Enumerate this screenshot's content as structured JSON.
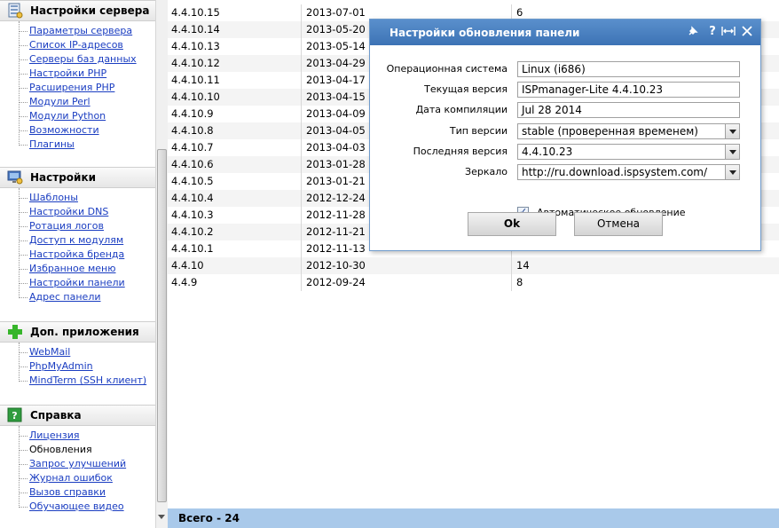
{
  "sidebar": {
    "sections": [
      {
        "title": "Настройки сервера",
        "icon": "server-settings-icon",
        "items": [
          "Параметры сервера",
          "Список IP-адресов",
          "Серверы баз данных",
          "Настройки PHP",
          "Расширения PHP",
          "Модули Perl",
          "Модули Python",
          "Возможности",
          "Плагины"
        ]
      },
      {
        "title": "Настройки",
        "icon": "settings-icon",
        "items": [
          "Шаблоны",
          "Настройки DNS",
          "Ротация логов",
          "Доступ к модулям",
          "Настройка бренда",
          "Избранное меню",
          "Настройки панели",
          "Адрес панели"
        ]
      },
      {
        "title": "Доп. приложения",
        "icon": "plus-icon",
        "items": [
          "WebMail",
          "PhpMyAdmin",
          "MindTerm (SSH клиент)"
        ]
      },
      {
        "title": "Справка",
        "icon": "help-icon",
        "items": [
          "Лицензия",
          "Обновления",
          "Запрос улучшений",
          "Журнал ошибок",
          "Вызов справки",
          "Обучающее видео"
        ],
        "active": "Обновления"
      }
    ]
  },
  "table": {
    "rows": [
      [
        "4.4.10.15",
        "2013-07-01",
        "6"
      ],
      [
        "4.4.10.14",
        "2013-05-20",
        ""
      ],
      [
        "4.4.10.13",
        "2013-05-14",
        ""
      ],
      [
        "4.4.10.12",
        "2013-04-29",
        ""
      ],
      [
        "4.4.10.11",
        "2013-04-17",
        ""
      ],
      [
        "4.4.10.10",
        "2013-04-15",
        ""
      ],
      [
        "4.4.10.9",
        "2013-04-09",
        ""
      ],
      [
        "4.4.10.8",
        "2013-04-05",
        ""
      ],
      [
        "4.4.10.7",
        "2013-04-03",
        ""
      ],
      [
        "4.4.10.6",
        "2013-01-28",
        ""
      ],
      [
        "4.4.10.5",
        "2013-01-21",
        ""
      ],
      [
        "4.4.10.4",
        "2012-12-24",
        ""
      ],
      [
        "4.4.10.3",
        "2012-11-28",
        ""
      ],
      [
        "4.4.10.2",
        "2012-11-21",
        ""
      ],
      [
        "4.4.10.1",
        "2012-11-13",
        ""
      ],
      [
        "4.4.10",
        "2012-10-30",
        "14"
      ],
      [
        "4.4.9",
        "2012-09-24",
        "8"
      ]
    ],
    "footer": "Всего - 24"
  },
  "dialog": {
    "title": "Настройки обновления панели",
    "header_icons": [
      "pin-icon",
      "help-icon",
      "expand-icon",
      "close-icon"
    ],
    "fields": [
      {
        "label": "Операционная система",
        "value": "Linux (i686)",
        "type": "text"
      },
      {
        "label": "Текущая версия",
        "value": "ISPmanager-Lite 4.4.10.23",
        "type": "text"
      },
      {
        "label": "Дата компиляции",
        "value": "Jul 28 2014",
        "type": "text"
      },
      {
        "label": "Тип версии",
        "value": "stable (проверенная временем)",
        "type": "select"
      },
      {
        "label": "Последняя версия",
        "value": "4.4.10.23",
        "type": "select"
      },
      {
        "label": "Зеркало",
        "value": "http://ru.download.ispsystem.com/",
        "type": "select"
      }
    ],
    "auto_update": {
      "label": "Автоматическое обновление",
      "checked": true
    },
    "ok_label": "Ok",
    "cancel_label": "Отмена"
  },
  "colors": {
    "link": "#1a3dc1",
    "dialog_header": "#4a7fc0",
    "footer_bar": "#a9c9ea"
  }
}
